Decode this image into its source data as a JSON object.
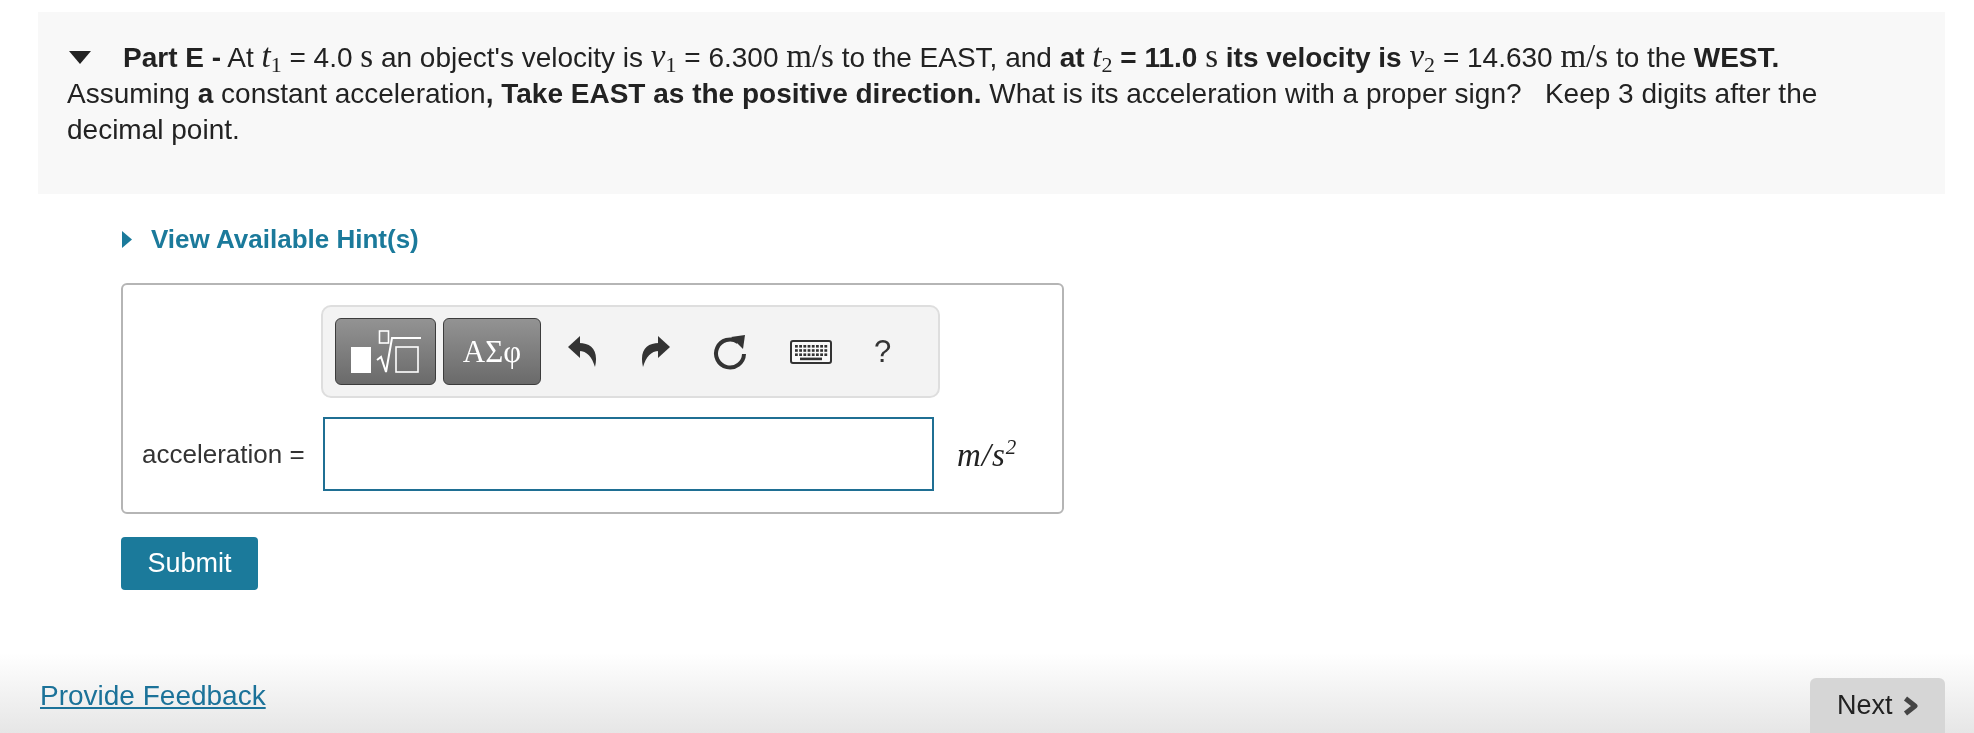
{
  "part": {
    "expanded": true,
    "title": "Part E -",
    "question": [
      {
        "kind": "text",
        "text": "At "
      },
      {
        "kind": "math",
        "text": "*t*$_{1}$"
      },
      {
        "kind": "text",
        "text": " = 4.0 "
      },
      {
        "kind": "math",
        "text": "s"
      },
      {
        "kind": "text",
        "text": " an object's velocity is "
      },
      {
        "kind": "math",
        "text": "*v*$_{1}$"
      },
      {
        "kind": "text",
        "text": " = 6.300 "
      },
      {
        "kind": "math",
        "text": "m/s"
      },
      {
        "kind": "text",
        "text": " to the EAST, and **at** "
      },
      {
        "kind": "math",
        "text": "*t*$_{2}$"
      },
      {
        "kind": "text",
        "text": " **= 11.0** "
      },
      {
        "kind": "math",
        "text": "s"
      },
      {
        "kind": "text",
        "text": " **its velocity is** "
      },
      {
        "kind": "math",
        "text": "*v*$_{2}$"
      },
      {
        "kind": "text",
        "text": " = 14.630 "
      },
      {
        "kind": "math",
        "text": "m/s"
      },
      {
        "kind": "text",
        "text": " to the **WEST.** Assuming **a** constant acceleration**, Take EAST as the positive direction.** What is its acceleration with a proper sign?   Keep 3 digits after the decimal point."
      }
    ]
  },
  "hint": {
    "label": "View Available Hint(s)",
    "expanded": false
  },
  "answer": {
    "toolbar": {
      "palettes": [
        {
          "kind": "templates"
        },
        {
          "kind": "symbols",
          "label": "ΑΣφ"
        }
      ],
      "actions": [
        {
          "kind": "undo"
        },
        {
          "kind": "redo"
        },
        {
          "kind": "reset"
        },
        {
          "kind": "keyboard"
        },
        {
          "kind": "help",
          "label": "?"
        }
      ]
    },
    "label": "acceleration =",
    "units": "m/s$^{2}$"
  },
  "submit": "Submit",
  "feedback_link": "Provide Feedback",
  "next": "Next"
}
